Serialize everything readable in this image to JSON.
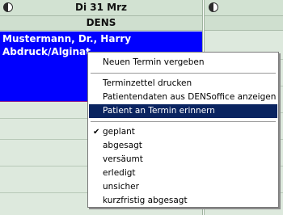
{
  "calendar": {
    "day_label": "Di 31 Mrz",
    "column_label": "DENS",
    "appointment": {
      "line1": "Mustermann, Dr., Harry",
      "line2": "Abdruck/Alginat"
    }
  },
  "context_menu": {
    "items": [
      {
        "label": "Neuen Termin vergeben"
      },
      {
        "label": "Terminzettel drucken"
      },
      {
        "label": "Patientendaten aus DENSoffice anzeigen"
      },
      {
        "label": "Patient an Termin erinnern",
        "highlighted": true
      },
      {
        "label": "geplant",
        "checked": true
      },
      {
        "label": "abgesagt"
      },
      {
        "label": "versäumt"
      },
      {
        "label": "erledigt"
      },
      {
        "label": "unsicher"
      },
      {
        "label": "kurzfristig abgesagt"
      }
    ],
    "check_glyph": "✔"
  },
  "colors": {
    "appointment_bg": "#0000ff",
    "menu_highlight": "#0a2460",
    "calendar_bg": "#dde9dd"
  },
  "icons": {
    "moon": "moon-phase-icon",
    "check": "checkmark-icon"
  }
}
